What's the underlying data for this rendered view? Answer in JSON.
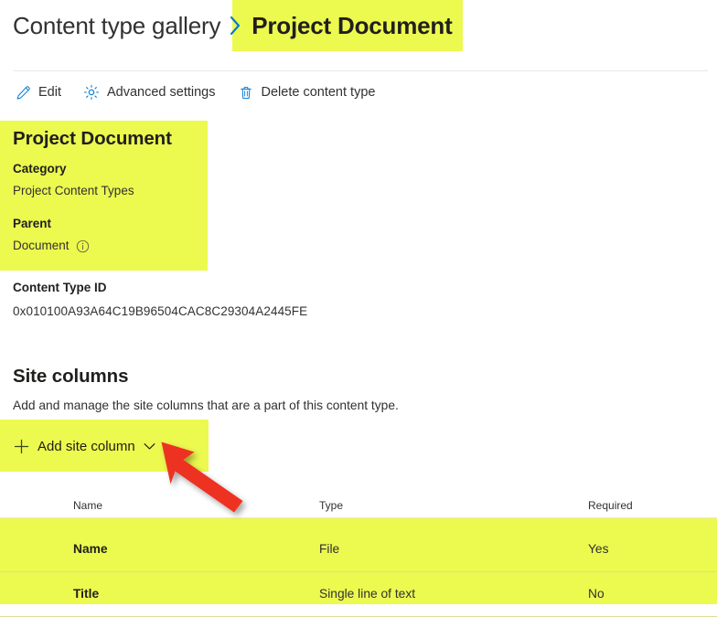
{
  "breadcrumb": {
    "root": "Content type gallery",
    "separator_icon": "chevron-right-icon",
    "current": "Project Document"
  },
  "commandbar": {
    "items": [
      {
        "label": "Edit",
        "icon": "pencil-icon"
      },
      {
        "label": "Advanced settings",
        "icon": "gear-icon"
      },
      {
        "label": "Delete content type",
        "icon": "trash-icon"
      }
    ]
  },
  "info_panel": {
    "title": "Project Document",
    "category_label": "Category",
    "category_value": "Project Content Types",
    "parent_label": "Parent",
    "parent_value": "Document",
    "parent_info_icon": "info-circle-icon"
  },
  "content_type_id": {
    "label": "Content Type ID",
    "value": "0x010100A93A64C19B96504CAC8C29304A2445FE"
  },
  "site_columns": {
    "title": "Site columns",
    "description": "Add and manage the site columns that are a part of this content type.",
    "add_button": {
      "label": "Add site column",
      "plus_icon": "plus-icon",
      "caret_icon": "chevron-down-icon"
    },
    "table": {
      "headers": [
        "Name",
        "Type",
        "Required"
      ],
      "rows": [
        {
          "name": "Name",
          "type": "File",
          "required": "Yes"
        },
        {
          "name": "Title",
          "type": "Single line of text",
          "required": "No"
        }
      ]
    }
  },
  "annotation": {
    "arrow_icon": "red-arrow-up-left-icon",
    "arrow_color": "#ee3124",
    "highlight_color": "#ecf94f"
  }
}
